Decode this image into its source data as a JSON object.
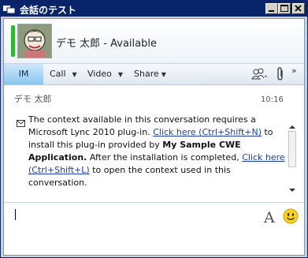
{
  "window": {
    "title": "会話のテスト"
  },
  "contact": {
    "name": "デモ 太郎",
    "separator": "-",
    "status": "Available",
    "presence_color": "#2eb82e"
  },
  "toolbar": {
    "im_label": "IM",
    "call_label": "Call",
    "video_label": "Video",
    "share_label": "Share"
  },
  "message": {
    "sender": "デモ 太郎",
    "time": "10:16",
    "parts": {
      "t1": "The context available in this conversation requires a Microsoft Lync 2010 plug-in. ",
      "link1": "Click here (Ctrl+Shift+N)",
      "t2": " to install this plug-in provided by ",
      "bold": "My Sample CWE Application.",
      "t3": " After the installation is completed, ",
      "link2": "Click here (Ctrl+Shift+L)",
      "t4": " to open the context used in this conversation."
    }
  },
  "compose": {
    "font_button": "A"
  }
}
